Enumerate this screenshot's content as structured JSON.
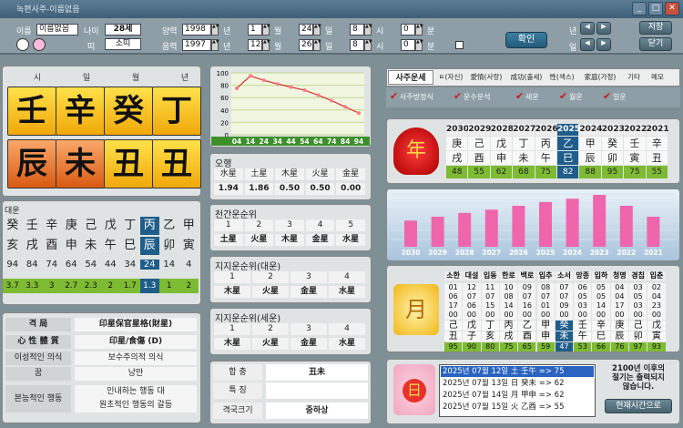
{
  "window": {
    "title": "녹편사주-이름없음"
  },
  "top": {
    "name_label": "이름",
    "name": "이름없음",
    "age_label": "나이",
    "age": "28세",
    "ddi_label": "띠",
    "ddi": "소띠",
    "solar_label": "양력",
    "lunar_label": "음력",
    "solar": {
      "year": "1998",
      "month": "1",
      "day": "24",
      "hour": "8",
      "min": "0"
    },
    "lunar": {
      "year": "1997",
      "month": "12",
      "day": "26",
      "hour": "8",
      "min": "0"
    },
    "year_u": "년",
    "month_u": "월",
    "day_u": "일",
    "hour_u": "시",
    "min_u": "분",
    "confirm": "확인",
    "save": "저장",
    "close": "닫기",
    "nyeon": "년",
    "il": "일"
  },
  "saju": {
    "headers": [
      "시",
      "일",
      "월",
      "년"
    ],
    "stems": [
      "壬",
      "辛",
      "癸",
      "丁"
    ],
    "branches": [
      "辰",
      "未",
      "丑",
      "丑"
    ]
  },
  "daeun": {
    "title": "대운",
    "stems": [
      "癸",
      "壬",
      "辛",
      "庚",
      "己",
      "戊",
      "丁",
      "丙",
      "乙",
      "甲"
    ],
    "branches": [
      "亥",
      "戌",
      "酉",
      "申",
      "未",
      "午",
      "巳",
      "辰",
      "卯",
      "寅"
    ],
    "ages": [
      "94",
      "84",
      "74",
      "64",
      "54",
      "44",
      "34",
      "24",
      "14",
      "4"
    ],
    "vals": [
      "3.7",
      "3.3",
      "3",
      "2.7",
      "2.3",
      "2",
      "1.7",
      "1.3",
      "1",
      "2"
    ]
  },
  "info": {
    "rows": [
      {
        "k": "격 局",
        "v": "印星保官星格(財星)"
      },
      {
        "k": "心 性 體 質",
        "v": "印星/食傷 (D)"
      },
      {
        "k": "이성적인 의식",
        "v": "보수주의적 의식"
      },
      {
        "k": "꿈",
        "v": "낭만"
      },
      {
        "k": "본능적인 행동",
        "v": "인내하는 행동 대\n원초적인 행동의 갈등"
      }
    ]
  },
  "chart_data": {
    "type": "line",
    "x": [
      4,
      14,
      24,
      34,
      44,
      54,
      64,
      74,
      84,
      94
    ],
    "values": [
      75,
      95,
      88,
      82,
      77,
      72,
      64,
      55,
      45,
      35
    ],
    "ylim": [
      0,
      100
    ],
    "yticks": [
      "100",
      "80",
      "60",
      "40",
      "20",
      "0"
    ],
    "xticks": [
      "04",
      "14",
      "24",
      "34",
      "44",
      "54",
      "64",
      "74",
      "84",
      "94"
    ]
  },
  "ohaeng": {
    "title": "오행",
    "heads": [
      "水星",
      "土星",
      "木星",
      "火星",
      "金星"
    ],
    "vals": [
      "1.94",
      "1.86",
      "0.50",
      "0.50",
      "0.00"
    ]
  },
  "cheongan": {
    "title": "천간운순위",
    "nums": [
      "1",
      "2",
      "3",
      "4",
      "5"
    ],
    "vals": [
      "土星",
      "火星",
      "木星",
      "金星",
      "水星"
    ]
  },
  "jiji_dae": {
    "title": "지지운순위(대운)",
    "nums": [
      "1",
      "2",
      "3",
      "4"
    ],
    "vals": [
      "木星",
      "火星",
      "金星",
      "水星"
    ]
  },
  "jiji_se": {
    "title": "지지운순위(세운)",
    "nums": [
      "1",
      "2",
      "3",
      "4"
    ],
    "vals": [
      "木星",
      "火星",
      "金星",
      "水星"
    ]
  },
  "hapchung": {
    "hap_k": "합 충",
    "hap_v": "丑未",
    "teuk_k": "특 징",
    "teuk_v": "",
    "gyeok_k": "격국크기",
    "gyeok_v": "중하상"
  },
  "tabs": [
    "사주운세",
    "ㅌ(자신)",
    "愛情(사랑)",
    "成功(출세)",
    "性(섹스)",
    "家庭(가정)",
    "기타",
    "메모"
  ],
  "checks": [
    "사주방정식",
    "운수분석",
    "세운",
    "월운",
    "일운"
  ],
  "seun": {
    "years": [
      "2030",
      "2029",
      "2028",
      "2027",
      "2026",
      "2025",
      "2024",
      "2023",
      "2022",
      "2021"
    ],
    "stems": [
      "庚",
      "己",
      "戊",
      "丁",
      "丙",
      "乙",
      "甲",
      "癸",
      "壬",
      "辛"
    ],
    "branches": [
      "戌",
      "酉",
      "申",
      "未",
      "午",
      "巳",
      "辰",
      "卯",
      "寅",
      "丑"
    ],
    "vals": [
      "48",
      "55",
      "62",
      "68",
      "75",
      "82",
      "88",
      "95",
      "75",
      "55"
    ]
  },
  "seun_chart": {
    "type": "bar",
    "categories": [
      "2030",
      "2029",
      "2028",
      "2027",
      "2026",
      "2025",
      "2024",
      "2023",
      "2022",
      "2021"
    ],
    "values": [
      48,
      55,
      62,
      68,
      75,
      82,
      88,
      95,
      75,
      55
    ]
  },
  "wolun": {
    "months": [
      "소한",
      "대설",
      "입동",
      "한로",
      "백로",
      "입추",
      "소서",
      "망종",
      "입하",
      "청명",
      "경칩",
      "입춘"
    ],
    "r1": [
      "01",
      "12",
      "11",
      "10",
      "09",
      "08",
      "07",
      "06",
      "05",
      "04",
      "03",
      "02"
    ],
    "r2": [
      "06",
      "07",
      "07",
      "08",
      "07",
      "07",
      "07",
      "05",
      "05",
      "04",
      "05",
      "04"
    ],
    "r3": [
      "17",
      "06",
      "15",
      "14",
      "16",
      "01",
      "09",
      "03",
      "14",
      "17",
      "03",
      "23"
    ],
    "r4": [
      "00",
      "00",
      "00",
      "00",
      "00",
      "00",
      "00",
      "00",
      "00",
      "00",
      "00",
      "00"
    ],
    "stems": [
      "己",
      "戊",
      "丁",
      "丙",
      "乙",
      "甲",
      "癸",
      "壬",
      "辛",
      "庚",
      "己",
      "戊"
    ],
    "branches": [
      "丑",
      "子",
      "亥",
      "戌",
      "酉",
      "申",
      "未",
      "午",
      "巳",
      "辰",
      "卯",
      "寅"
    ],
    "vals": [
      "95",
      "90",
      "80",
      "75",
      "65",
      "59",
      "47",
      "53",
      "66",
      "76",
      "97",
      "93"
    ]
  },
  "ilun": {
    "items": [
      "2025년 07월 12일 土 壬午 => 75",
      "2025년 07월 13일 日 癸未 => 62",
      "2025년 07월 14일 月 甲申 => 62",
      "2025년 07월 15일 火 乙酉 => 55"
    ],
    "note": "2100년 이후의\n절기는 출력되지\n않습니다.",
    "now_btn": "현재시간으로"
  }
}
